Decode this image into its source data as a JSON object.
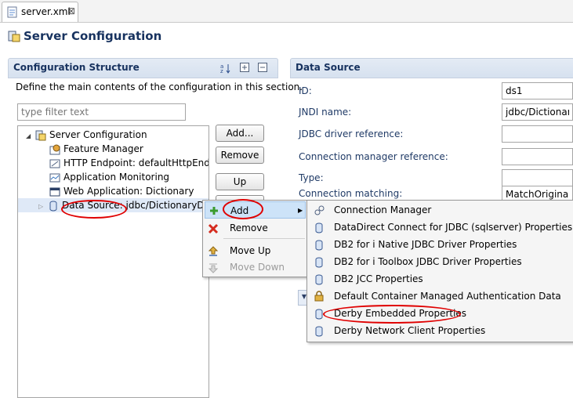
{
  "editor_tab": {
    "label": "server.xml",
    "close": "⊠"
  },
  "header": {
    "title": "Server Configuration"
  },
  "structure": {
    "title": "Configuration Structure",
    "description": "Define the main contents of the configuration in this section.",
    "filter_placeholder": "type filter text",
    "tree": [
      {
        "label": "Server Configuration",
        "icon": "server-config-icon"
      },
      {
        "label": "Feature Manager",
        "icon": "feature-manager-icon"
      },
      {
        "label": "HTTP Endpoint: defaultHttpEndpoint",
        "icon": "http-endpoint-icon"
      },
      {
        "label": "Application Monitoring",
        "icon": "monitor-icon"
      },
      {
        "label": "Web Application: Dictionary",
        "icon": "web-app-icon"
      },
      {
        "label": "Data Source: jdbc/DictionaryDB",
        "icon": "datasource-icon"
      }
    ],
    "buttons": {
      "add": "Add...",
      "remove": "Remove",
      "up": "Up"
    }
  },
  "datasource": {
    "title": "Data Source",
    "fields": [
      {
        "label": "ID:",
        "value": "ds1"
      },
      {
        "label": "JNDI name:",
        "value": "jdbc/DictionaryDB"
      },
      {
        "label": "JDBC driver reference:",
        "value": ""
      },
      {
        "label": "Connection manager reference:",
        "value": ""
      },
      {
        "label": "Type:",
        "value": ""
      },
      {
        "label": "Connection matching:",
        "value": "MatchOriginalRequest"
      }
    ]
  },
  "context_menu": {
    "items": [
      {
        "label": "Add",
        "icon": "plus-icon",
        "submenu_arrow": "▶"
      },
      {
        "label": "Remove",
        "icon": "delete-icon"
      },
      {
        "label": "Move Up",
        "icon": "move-up-icon"
      },
      {
        "label": "Move Down",
        "icon": "move-down-icon",
        "disabled": true
      }
    ]
  },
  "submenu": {
    "items": [
      {
        "label": "Connection Manager",
        "icon": "connection-manager-icon"
      },
      {
        "label": "DataDirect Connect for JDBC (sqlserver) Properties",
        "icon": "properties-icon"
      },
      {
        "label": "DB2 for i Native JDBC Driver Properties",
        "icon": "properties-icon"
      },
      {
        "label": "DB2 for i Toolbox JDBC Driver Properties",
        "icon": "properties-icon"
      },
      {
        "label": "DB2 JCC Properties",
        "icon": "properties-icon"
      },
      {
        "label": "Default Container Managed Authentication Data",
        "icon": "lock-icon"
      },
      {
        "label": "Derby Embedded Properties",
        "icon": "properties-icon"
      },
      {
        "label": "Derby Network Client Properties",
        "icon": "properties-icon"
      }
    ]
  },
  "colors": {
    "section_title": "#17325f",
    "highlight_ring": "#e00000",
    "menu_hover": "#cde3f8"
  }
}
